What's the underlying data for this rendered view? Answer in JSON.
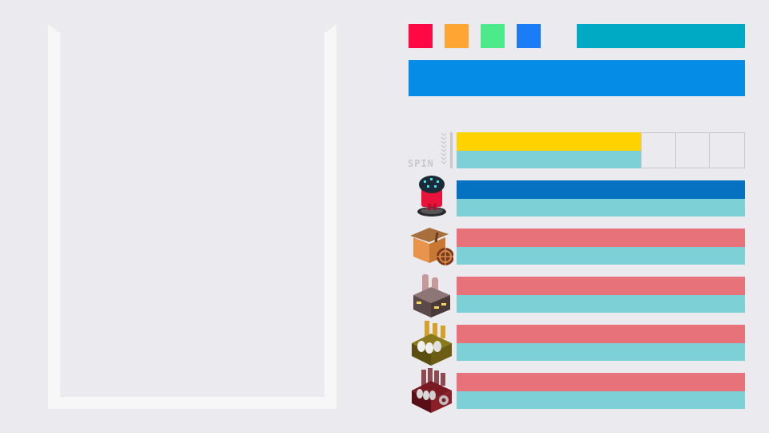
{
  "spin": {
    "label": "SPIN",
    "progress": 0.64
  },
  "palette": {
    "swatches": [
      "#ff0844",
      "#ffa534",
      "#4dea8a",
      "#1b7cf7"
    ],
    "wide_bar": "#00aac4",
    "big_bar": "#058ce6",
    "spin_top": "#ffd200",
    "progress_bottom": "#7dd1d6",
    "row1_top": "#0572c1",
    "row_top": "#e8727a",
    "track_border": "#c8c8cc"
  },
  "upgrades": [
    {
      "name": "robot-icon",
      "top_color": "#0572c1"
    },
    {
      "name": "workshop-icon",
      "top_color": "#e8727a"
    },
    {
      "name": "factory-icon",
      "top_color": "#e8727a"
    },
    {
      "name": "gold-factory-icon",
      "top_color": "#e8727a"
    },
    {
      "name": "red-factory-icon",
      "top_color": "#e8727a"
    }
  ]
}
